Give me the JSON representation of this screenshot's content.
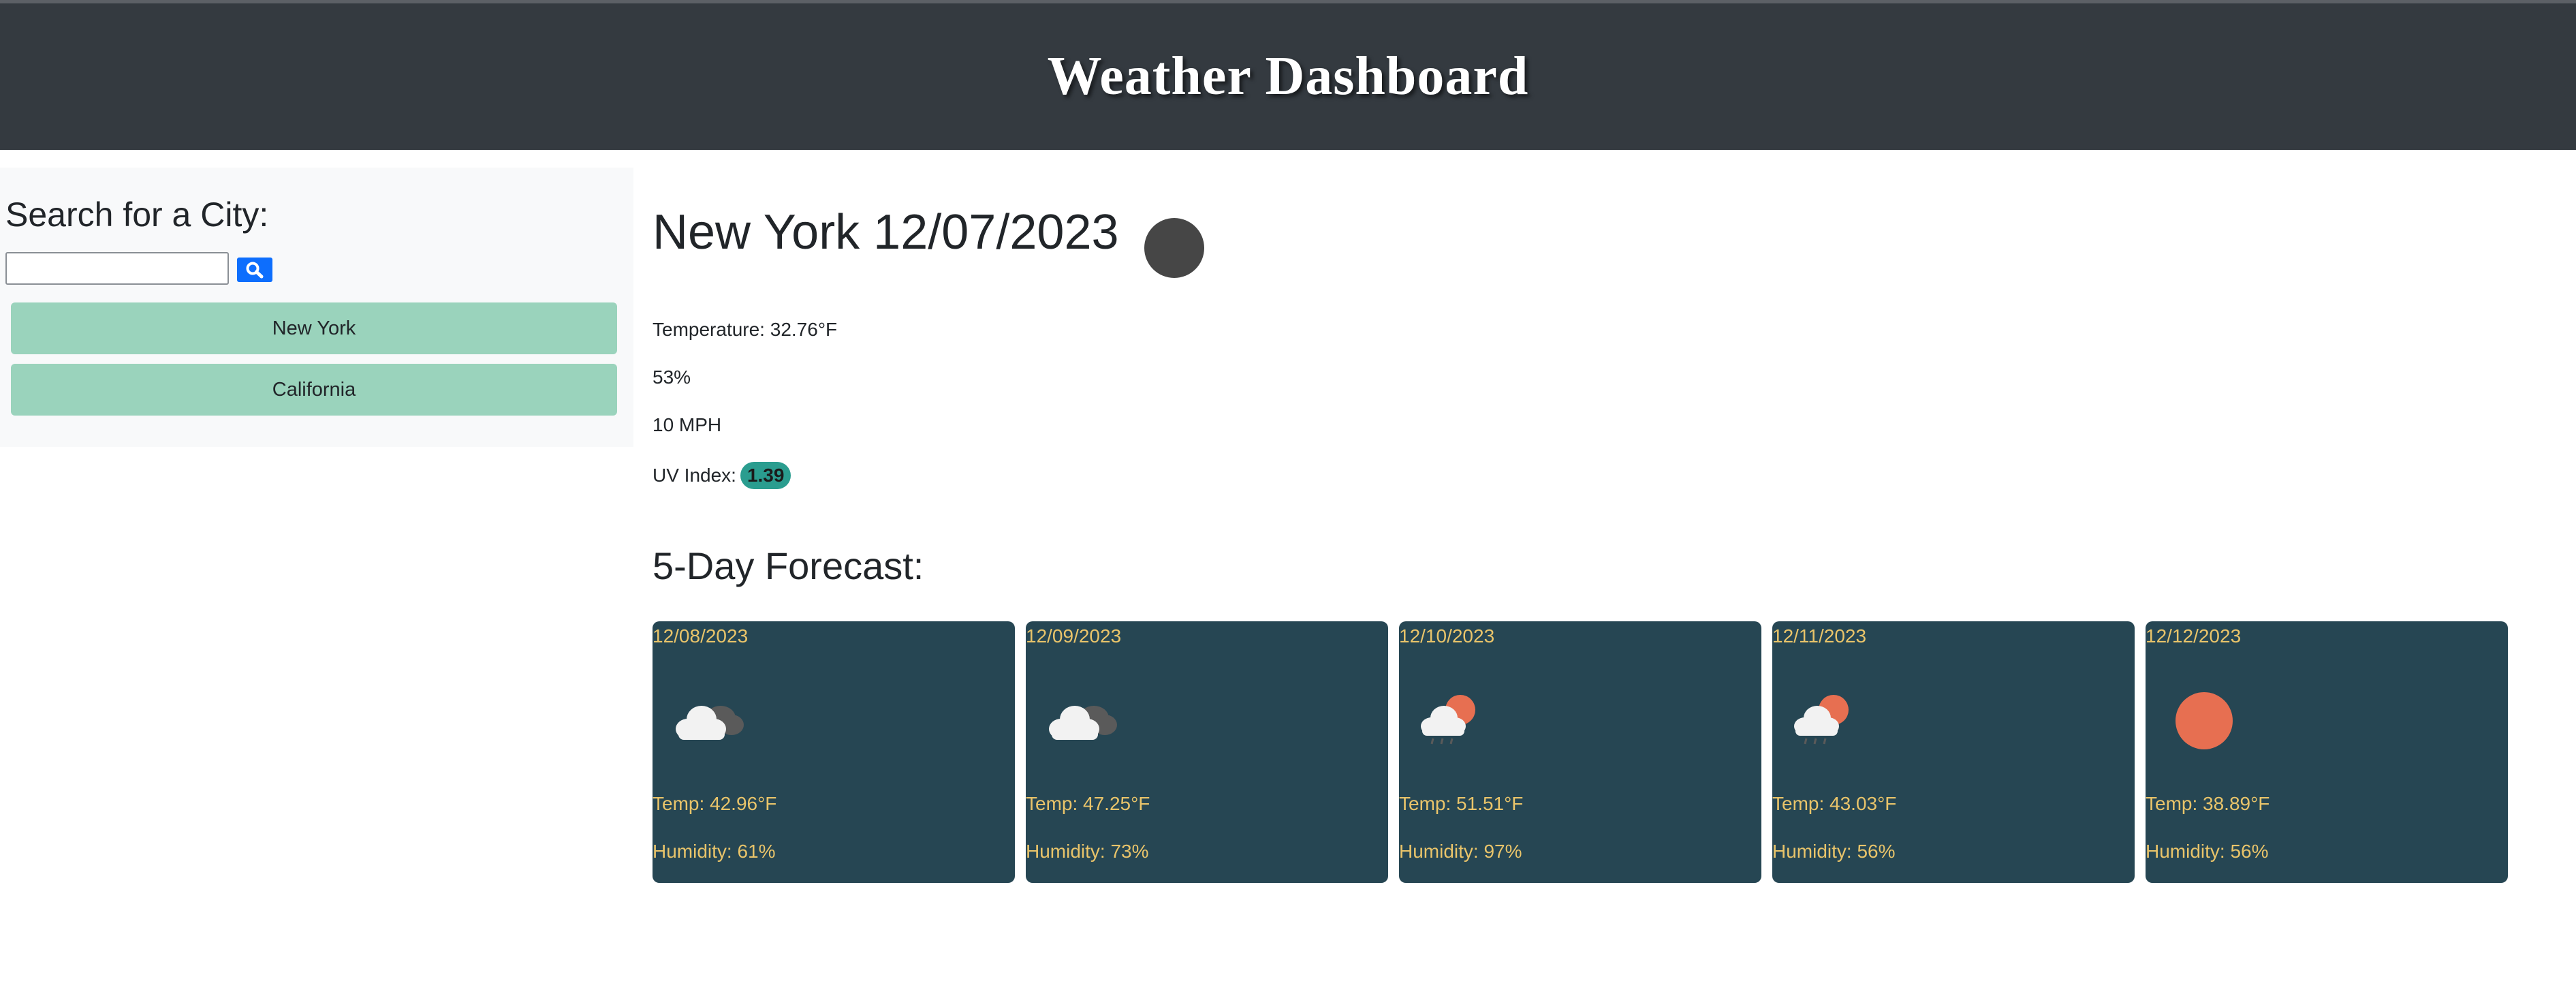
{
  "header": {
    "title": "Weather Dashboard"
  },
  "sidebar": {
    "heading": "Search for a City:",
    "search_value": "",
    "search_icon": "search-icon",
    "history": [
      "New York",
      "California"
    ]
  },
  "current": {
    "title": "New York 12/07/2023",
    "icon": "cloud-icon",
    "temperature": "Temperature: 32.76°F",
    "humidity": "53%",
    "wind": "10 MPH",
    "uv_label": "UV Index:",
    "uv_value": "1.39"
  },
  "forecast": {
    "heading": "5-Day Forecast:",
    "days": [
      {
        "date": "12/08/2023",
        "icon": "cloudy-icon",
        "temp": "Temp: 42.96°F",
        "humidity": "Humidity: 61%"
      },
      {
        "date": "12/09/2023",
        "icon": "cloudy-icon",
        "temp": "Temp: 47.25°F",
        "humidity": "Humidity: 73%"
      },
      {
        "date": "12/10/2023",
        "icon": "rain-sun-icon",
        "temp": "Temp: 51.51°F",
        "humidity": "Humidity: 97%"
      },
      {
        "date": "12/11/2023",
        "icon": "rain-sun-icon",
        "temp": "Temp: 43.03°F",
        "humidity": "Humidity: 56%"
      },
      {
        "date": "12/12/2023",
        "icon": "sun-icon",
        "temp": "Temp: 38.89°F",
        "humidity": "Humidity: 56%"
      }
    ]
  },
  "colors": {
    "header_bg": "#343a40",
    "history_button": "#9ad3bc",
    "card_bg": "#264653",
    "card_text": "#e9c46a",
    "uv_badge": "#2a9d8f",
    "sun": "#e76f51",
    "search_button": "#0d6efd"
  }
}
